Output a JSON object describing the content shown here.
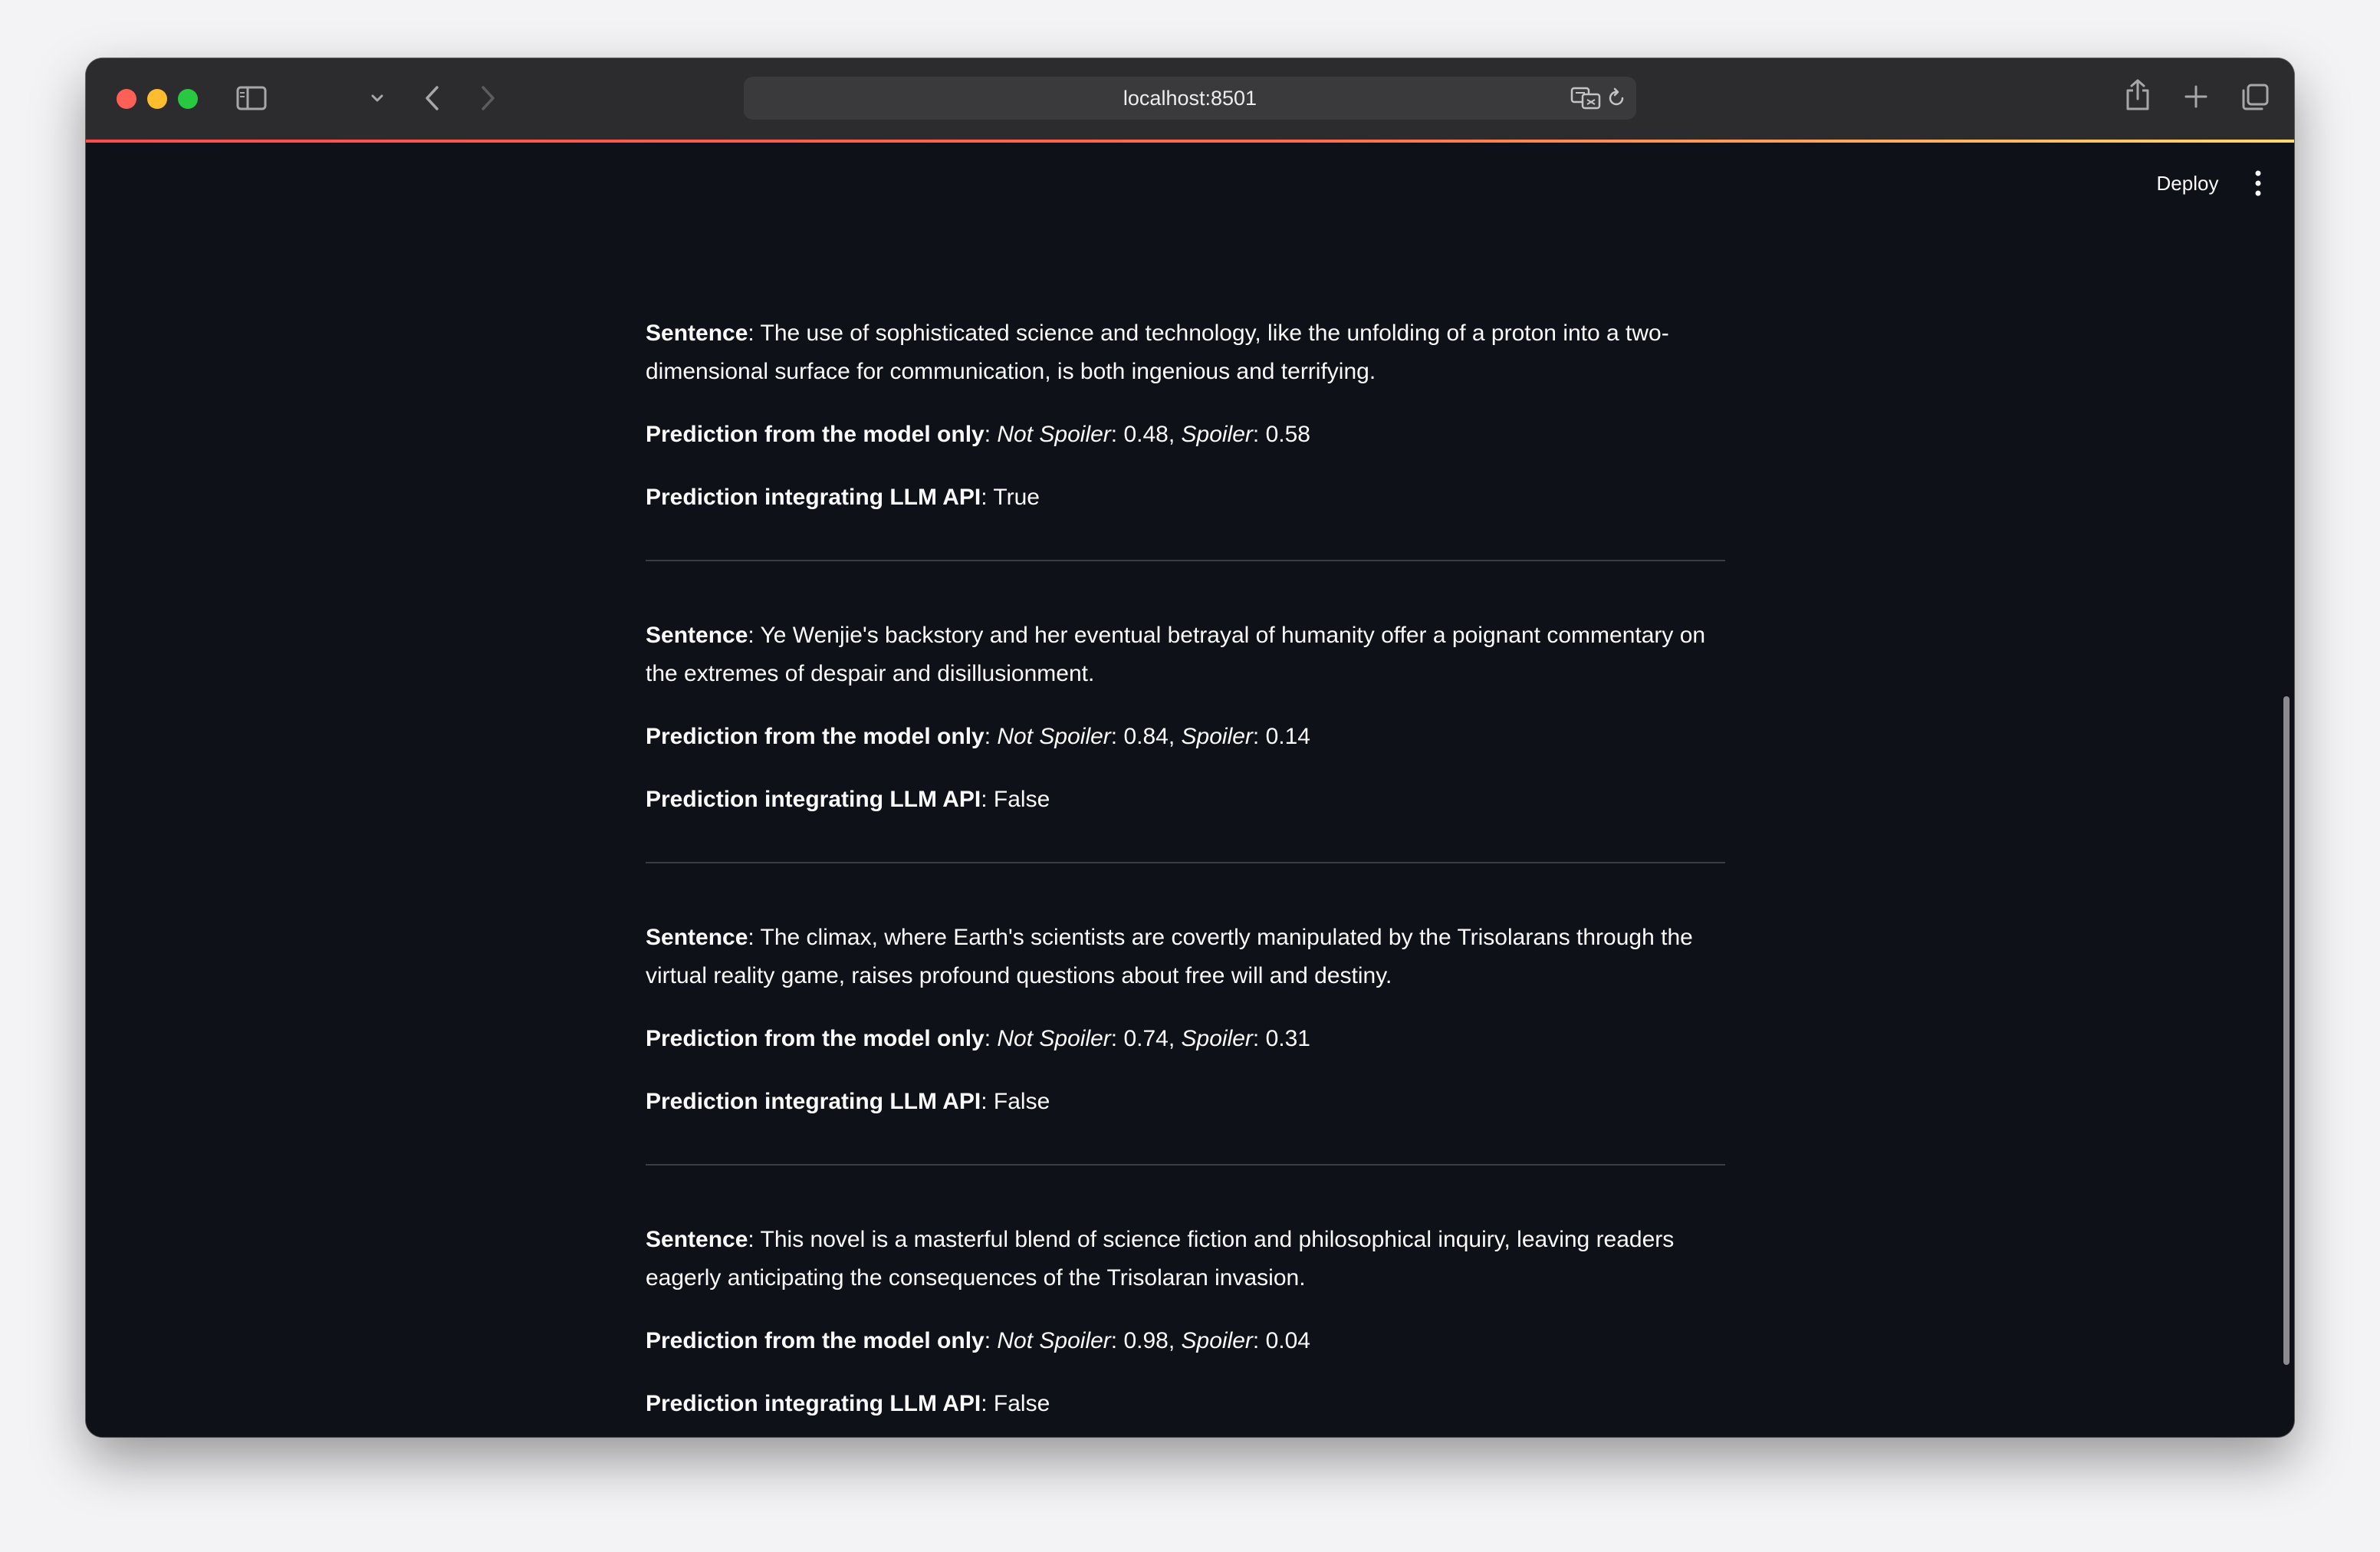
{
  "browser": {
    "url": "localhost:8501"
  },
  "app_header": {
    "deploy_label": "Deploy"
  },
  "entries": [
    {
      "sentence_label": "Sentence",
      "sentence": "The use of sophisticated science and technology, like the unfolding of a proton into a two-dimensional surface for communication, is both ingenious and terrifying.",
      "model_label": "Prediction from the model only",
      "not_spoiler_label": "Not Spoiler",
      "not_spoiler_score": "0.48",
      "spoiler_label": "Spoiler",
      "spoiler_score": "0.58",
      "llm_label": "Prediction integrating LLM API",
      "llm_value": "True"
    },
    {
      "sentence_label": "Sentence",
      "sentence": "Ye Wenjie's backstory and her eventual betrayal of humanity offer a poignant commentary on the extremes of despair and disillusionment.",
      "model_label": "Prediction from the model only",
      "not_spoiler_label": "Not Spoiler",
      "not_spoiler_score": "0.84",
      "spoiler_label": "Spoiler",
      "spoiler_score": "0.14",
      "llm_label": "Prediction integrating LLM API",
      "llm_value": "False"
    },
    {
      "sentence_label": "Sentence",
      "sentence": "The climax, where Earth's scientists are covertly manipulated by the Trisolarans through the virtual reality game, raises profound questions about free will and destiny.",
      "model_label": "Prediction from the model only",
      "not_spoiler_label": "Not Spoiler",
      "not_spoiler_score": "0.74",
      "spoiler_label": "Spoiler",
      "spoiler_score": "0.31",
      "llm_label": "Prediction integrating LLM API",
      "llm_value": "False"
    },
    {
      "sentence_label": "Sentence",
      "sentence": "This novel is a masterful blend of science fiction and philosophical inquiry, leaving readers eagerly anticipating the consequences of the Trisolaran invasion.",
      "model_label": "Prediction from the model only",
      "not_spoiler_label": "Not Spoiler",
      "not_spoiler_score": "0.98",
      "spoiler_label": "Spoiler",
      "spoiler_score": "0.04",
      "llm_label": "Prediction integrating LLM API",
      "llm_value": "False"
    }
  ],
  "icons": {
    "sidebar": "sidebar-icon",
    "chevron": "chevron-down-icon",
    "back": "back-icon",
    "forward": "forward-icon",
    "translate": "translate-icon",
    "reload": "reload-icon",
    "share": "share-icon",
    "new_tab": "plus-icon",
    "tabs": "tabs-overview-icon",
    "menu": "kebab-menu-icon"
  },
  "colors": {
    "background": "#0e1117",
    "text": "#fafafa",
    "accent": "#ff4b4b",
    "divider": "#3a3d45"
  }
}
